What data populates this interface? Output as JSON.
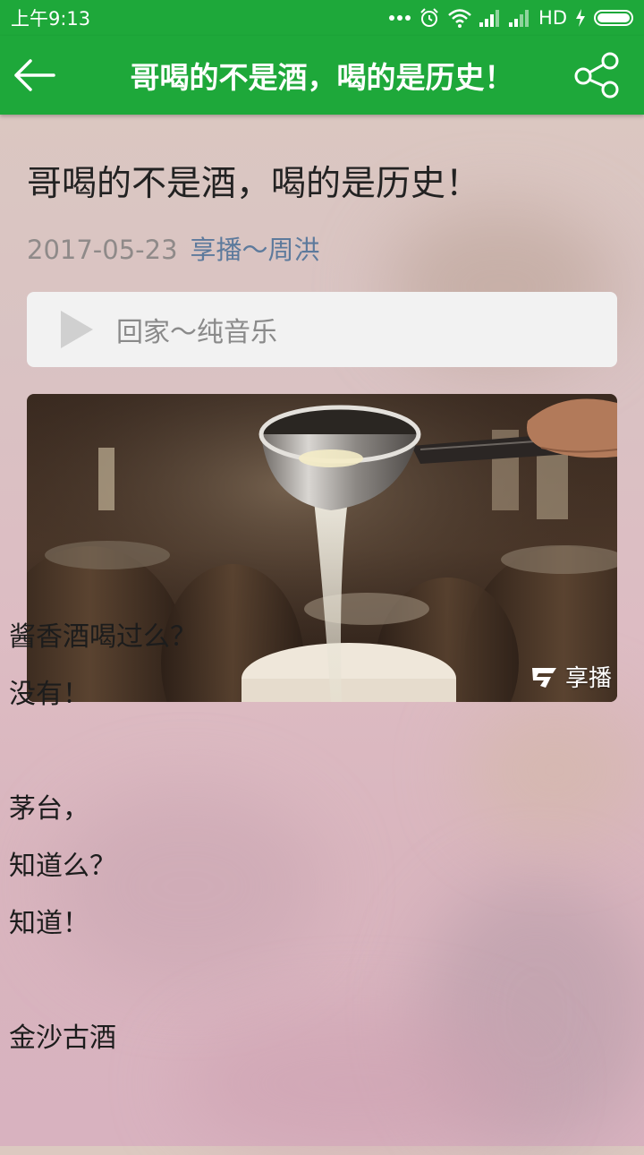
{
  "status_bar": {
    "time": "上午9:13",
    "network": "HD"
  },
  "app_bar": {
    "title": "哥喝的不是酒，喝的是历史！",
    "back_icon": "arrow-left-icon",
    "share_icon": "share-icon"
  },
  "article": {
    "title": "哥喝的不是酒，喝的是历史！",
    "date": "2017-05-23",
    "author": "享播～周洪",
    "music": {
      "title": "回家～纯音乐",
      "icon": "play-icon"
    },
    "image": {
      "watermark": "享播"
    },
    "paragraphs": [
      "酱香酒喝过么？",
      "没有！",
      "",
      "茅台，",
      "知道么？",
      "知道！",
      "",
      "金沙古酒"
    ]
  },
  "colors": {
    "accent": "#1ea83a",
    "author_link": "#5d7a9c"
  }
}
